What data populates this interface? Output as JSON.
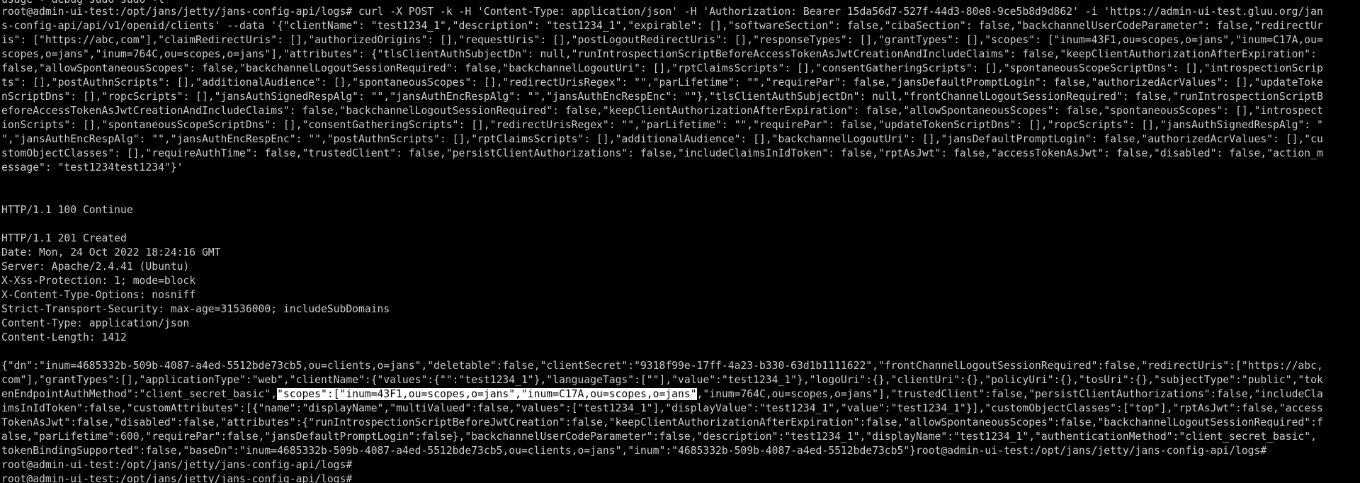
{
  "terminal": {
    "cut_top": "usage - debug sudo sudo -l",
    "command_lines": [
      "root@admin-ui-test:/opt/jans/jetty/jans-config-api/logs# curl -X POST -k -H 'Content-Type: application/json' -H 'Authorization: Bearer 15da56d7-527f-44d3-80e8-9ce5b8d9d862' -i 'https://admin-ui-test.gluu.org/jan",
      "s-config-api/api/v1/openid/clients' --data '{\"clientName\": \"test1234_1\",\"description\": \"test1234_1\",\"expirable\": [],\"softwareSection\": false,\"cibaSection\": false,\"backchannelUserCodeParameter\": false,\"redirectUr",
      "is\": [\"https://abc,com\"],\"claimRedirectUris\": [],\"authorizedOrigins\": [],\"requestUris\": [],\"postLogoutRedirectUris\": [],\"responseTypes\": [],\"grantTypes\": [],\"scopes\": [\"inum=43F1,ou=scopes,o=jans\",\"inum=C17A,ou=",
      "scopes,o=jans\",\"inum=764C,ou=scopes,o=jans\"],\"attributes\": {\"tlsClientAuthSubjectDn\": null,\"runIntrospectionScriptBeforeAccessTokenAsJwtCreationAndIncludeClaims\": false,\"keepClientAuthorizationAfterExpiration\":",
      "false,\"allowSpontaneousScopes\": false,\"backchannelLogoutSessionRequired\": false,\"backchannelLogoutUri\": [],\"rptClaimsScripts\": [],\"consentGatheringScripts\": [],\"spontaneousScopeScriptDns\": [],\"introspectionScrip",
      "ts\": [],\"postAuthnScripts\": [],\"additionalAudience\": [],\"spontaneousScopes\": [],\"redirectUrisRegex\": \"\",\"parLifetime\": \"\",\"requirePar\": false,\"jansDefaultPromptLogin\": false,\"authorizedAcrValues\": [],\"updateToke",
      "nScriptDns\": [],\"ropcScripts\": [],\"jansAuthSignedRespAlg\": \"\",\"jansAuthEncRespAlg\": \"\",\"jansAuthEncRespEnc\": \"\"},\"tlsClientAuthSubjectDn\": null,\"frontChannelLogoutSessionRequired\": false,\"runIntrospectionScriptB",
      "eforeAccessTokenAsJwtCreationAndIncludeClaims\": false,\"backchannelLogoutSessionRequired\": false,\"keepClientAuthorizationAfterExpiration\": false,\"allowSpontaneousScopes\": false,\"spontaneousScopes\": [],\"introspect",
      "ionScripts\": [],\"spontaneousScopeScriptDns\": [],\"consentGatheringScripts\": [],\"redirectUrisRegex\": \"\",\"parLifetime\": \"\",\"requirePar\": false,\"updateTokenScriptDns\": [],\"ropcScripts\": [],\"jansAuthSignedRespAlg\": \"",
      "\",\"jansAuthEncRespAlg\": \"\",\"jansAuthEncRespEnc\": \"\",\"postAuthnScripts\": [],\"rptClaimsScripts\": [],\"additionalAudience\": [],\"backchannelLogoutUri\": [],\"jansDefaultPromptLogin\": false,\"authorizedAcrValues\": [],\"cu",
      "stomObjectClasses\": [],\"requireAuthTime\": false,\"trustedClient\": false,\"persistClientAuthorizations\": false,\"includeClaimsInIdToken\": false,\"rptAsJwt\": false,\"accessTokenAsJwt\": false,\"disabled\": false,\"action_m",
      "essage\": \"test1234test1234\"}'"
    ],
    "continue_line": "HTTP/1.1 100 Continue",
    "headers": [
      "HTTP/1.1 201 Created",
      "Date: Mon, 24 Oct 2022 18:24:16 GMT",
      "Server: Apache/2.4.41 (Ubuntu)",
      "X-Xss-Protection: 1; mode=block",
      "X-Content-Type-Options: nosniff",
      "Strict-Transport-Security: max-age=31536000; includeSubDomains",
      "Content-Type: application/json",
      "Content-Length: 1412"
    ],
    "body_line1": "{\"dn\":\"inum=4685332b-509b-4087-a4ed-5512bde73cb5,ou=clients,o=jans\",\"deletable\":false,\"clientSecret\":\"9318f99e-17ff-4a23-b330-63d1b1111622\",\"frontChannelLogoutSessionRequired\":false,\"redirectUris\":[\"https://abc,",
    "body_line2": "com\"],\"grantTypes\":[],\"applicationType\":\"web\",\"clientName\":{\"values\":{\"\":\"test1234_1\"},\"languageTags\":[\"\"],\"value\":\"test1234_1\"},\"logoUri\":{},\"clientUri\":{},\"policyUri\":{},\"tosUri\":{},\"subjectType\":\"public\",\"tok",
    "body_line3_pre": "enEndpointAuthMethod\":\"client_secret_basic\",",
    "body_line3_hl": "\"scopes\":[\"inum=43F1,ou=scopes,o=jans\",\"inum=C17A,ou=scopes,o=jans\"",
    "body_line3_post": ",\"inum=764C,ou=scopes,o=jans\"],\"trustedClient\":false,\"persistClientAuthorizations\":false,\"includeCla",
    "body_rest": [
      "imsInIdToken\":false,\"customAttributes\":[{\"name\":\"displayName\",\"multiValued\":false,\"values\":[\"test1234_1\"],\"displayValue\":\"test1234_1\",\"value\":\"test1234_1\"}],\"customObjectClasses\":[\"top\"],\"rptAsJwt\":false,\"access",
      "TokenAsJwt\":false,\"disabled\":false,\"attributes\":{\"runIntrospectionScriptBeforeJwtCreation\":false,\"keepClientAuthorizationAfterExpiration\":false,\"allowSpontaneousScopes\":false,\"backchannelLogoutSessionRequired\":f",
      "alse,\"parLifetime\":600,\"requirePar\":false,\"jansDefaultPromptLogin\":false},\"backchannelUserCodeParameter\":false,\"description\":\"test1234_1\",\"displayName\":\"test1234_1\",\"authenticationMethod\":\"client_secret_basic\",",
      "tokenBindingSupported\":false,\"baseDn\":\"inum=4685332b-509b-4087-a4ed-5512bde73cb5,ou=clients,o=jans\",\"inum\":\"4685332b-509b-4087-a4ed-5512bde73cb5\"}root@admin-ui-test:/opt/jans/jetty/jans-config-api/logs#"
    ],
    "prompts": [
      "root@admin-ui-test:/opt/jans/jetty/jans-config-api/logs#",
      "root@admin-ui-test:/opt/jans/jetty/jans-config-api/logs#"
    ]
  }
}
